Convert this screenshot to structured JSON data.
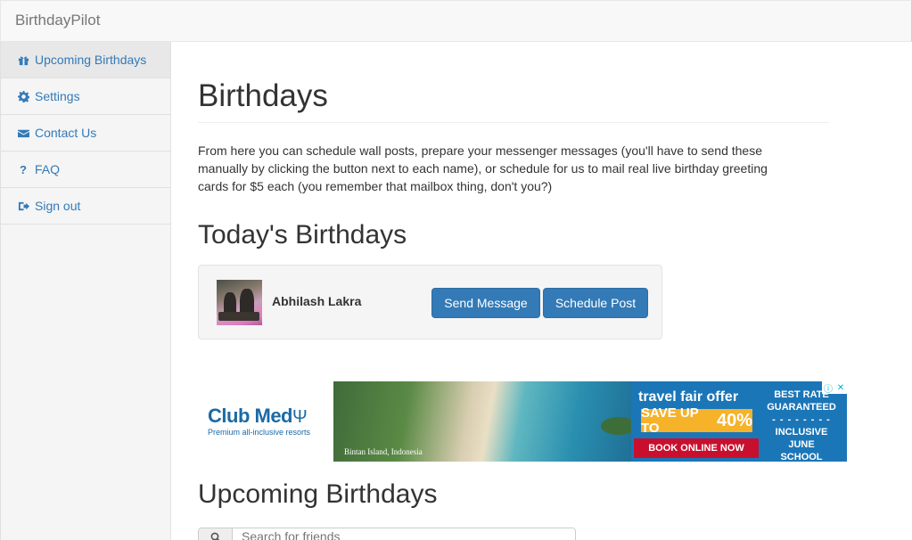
{
  "app": {
    "brand": "BirthdayPilot"
  },
  "sidebar": {
    "items": [
      {
        "label": "Upcoming Birthdays",
        "icon": "gift-icon",
        "active": true
      },
      {
        "label": "Settings",
        "icon": "gear-icon"
      },
      {
        "label": "Contact Us",
        "icon": "envelope-icon"
      },
      {
        "label": "FAQ",
        "icon": "question-icon"
      },
      {
        "label": "Sign out",
        "icon": "sign-out-icon"
      }
    ]
  },
  "main": {
    "title": "Birthdays",
    "intro": "From here you can schedule wall posts, prepare your messenger messages (you'll have to send these manually by clicking the button next to each name), or schedule for us to mail real live birthday greeting cards for $5 each (you remember that mailbox thing, don't you?)",
    "today_title": "Today's Birthdays",
    "today": [
      {
        "name": "Abhilash Lakra",
        "send_message": "Send Message",
        "schedule_post": "Schedule Post"
      }
    ],
    "upcoming_title": "Upcoming Birthdays",
    "search_placeholder": "Search for friends"
  },
  "ad": {
    "logo": "Club Med",
    "tagline": "Premium all-inclusive resorts",
    "photo_caption": "Bintan Island, Indonesia",
    "headline": "travel fair offer",
    "save_prefix": "SAVE UP TO",
    "save_value": "40%",
    "cta": "BOOK ONLINE NOW",
    "best_rate_1": "BEST RATE",
    "best_rate_2": "GUARANTEED",
    "dashes": "- - - - - - - -",
    "best_rate_3": "INCLUSIVE JUNE",
    "best_rate_4": "SCHOOL HOLIDAY",
    "colors": {
      "blue": "#1b76b8",
      "yellow": "#f6b229",
      "red": "#c8102e"
    }
  },
  "colors": {
    "link": "#337ab7",
    "button": "#337ab7"
  }
}
